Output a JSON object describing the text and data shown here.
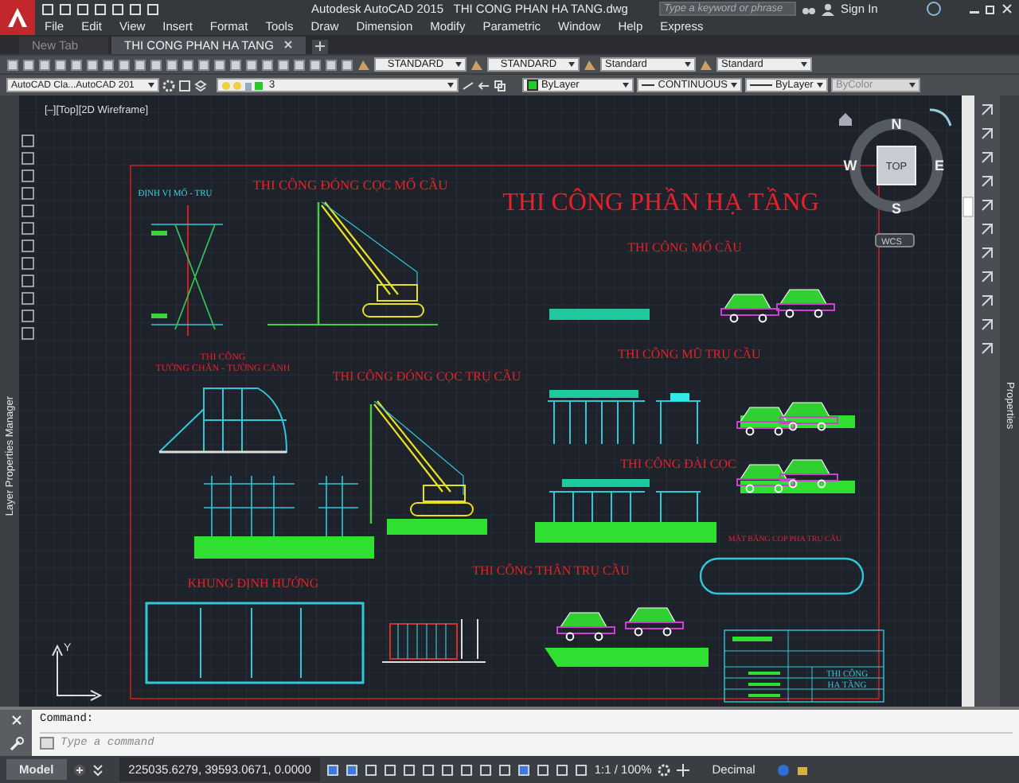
{
  "app": {
    "title": "Autodesk AutoCAD 2015",
    "file": "THI CONG PHAN HA TANG.dwg"
  },
  "search": {
    "placeholder": "Type a keyword or phrase"
  },
  "sign_in": "Sign In",
  "menu": [
    "File",
    "Edit",
    "View",
    "Insert",
    "Format",
    "Tools",
    "Draw",
    "Dimension",
    "Modify",
    "Parametric",
    "Window",
    "Help",
    "Express"
  ],
  "tabs": [
    {
      "label": "New Tab",
      "selected": false
    },
    {
      "label": "THI CONG PHAN HA TANG",
      "selected": true
    }
  ],
  "style_boxes": [
    "STANDARD",
    "STANDARD",
    "Standard",
    "Standard"
  ],
  "properties_bar": {
    "workspace": "AutoCAD Cla...AutoCAD 201",
    "layer": "3",
    "color_setting": "ByLayer",
    "linetype": "CONTINUOUS",
    "lineweight": "ByLayer",
    "plot_style": "ByColor"
  },
  "viewport_label": "[–][Top][2D Wireframe]",
  "viewcube": {
    "north": "N",
    "south": "S",
    "east": "E",
    "west": "W",
    "face": "TOP",
    "ucs": "WCS"
  },
  "drawing": {
    "title": "THI CÔNG PHẦN HẠ TẦNG",
    "labels": [
      {
        "text": "ĐỊNH VỊ MỐ - TRỤ",
        "kind": "note"
      },
      {
        "text": "THI CÔNG ĐÓNG CỌC MỐ CẦU",
        "kind": "heading"
      },
      {
        "text": "THI CÔNG MỐ CẦU",
        "kind": "heading"
      },
      {
        "text": "THI CÔNG",
        "kind": "caption"
      },
      {
        "text": "TƯỜNG CHẮN - TƯỜNG CÁNH",
        "kind": "caption"
      },
      {
        "text": "THI CÔNG ĐÓNG CỌC TRỤ CẦU",
        "kind": "heading"
      },
      {
        "text": "THI CÔNG MŨ TRỤ CẦU",
        "kind": "heading"
      },
      {
        "text": "THI CÔNG ĐÀI CỌC",
        "kind": "heading"
      },
      {
        "text": "MẶT BẰNG COP PHA TRỤ CẦU",
        "kind": "caption"
      },
      {
        "text": "THI CÔNG THÂN TRỤ CẦU",
        "kind": "heading"
      },
      {
        "text": "KHUNG ĐỊNH HƯỚNG",
        "kind": "heading"
      }
    ],
    "title_block": [
      "THI CÔNG",
      "HẠ TẦNG"
    ],
    "ucs_axis": "Y"
  },
  "side_palettes": {
    "left": "Layer Properties Manager",
    "right": "Properties"
  },
  "command_line": {
    "history": "Command:",
    "placeholder": "Type a command"
  },
  "status_bar": {
    "layout_tab": "Model",
    "coordinates": "225035.6279, 39593.0671, 0.0000",
    "scale": "1:1 / 100%",
    "units": "Decimal"
  }
}
